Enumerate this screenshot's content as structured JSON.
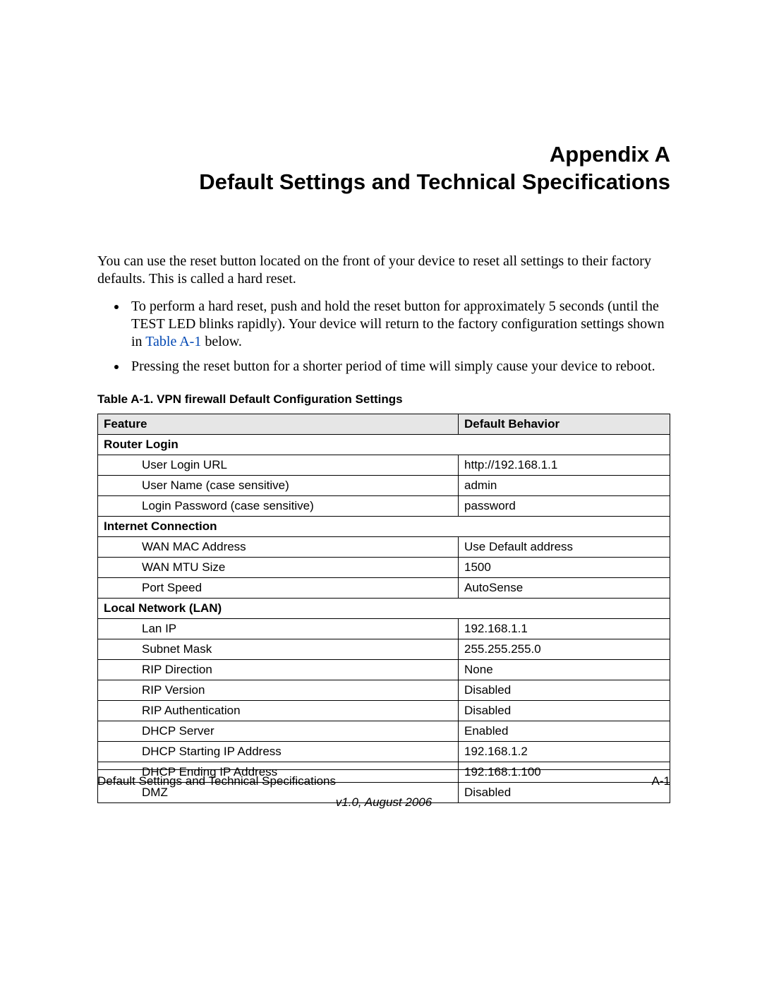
{
  "title_line1": "Appendix A",
  "title_line2": "Default Settings and Technical Specifications",
  "intro": "You can use the reset button located on the front of your device to reset all settings to their factory defaults. This is called a hard reset.",
  "bullet1_pre": "To perform a hard reset, push and hold the reset button for approximately 5 seconds (until the TEST LED blinks rapidly). Your device will return to the factory configuration settings shown in ",
  "bullet1_link": "Table A-1",
  "bullet1_post": " below.",
  "bullet2": "Pressing the reset button for a shorter period of time will simply cause your device to reboot.",
  "table_caption": "Table A-1.  VPN firewall Default Configuration Settings",
  "headers": {
    "feature": "Feature",
    "behavior": "Default Behavior"
  },
  "sections": {
    "router_login": "Router Login",
    "internet": "Internet Connection",
    "lan": "Local Network (LAN)"
  },
  "rows": {
    "r1": {
      "f": "User Login URL",
      "v": "http://192.168.1.1"
    },
    "r2": {
      "f": "User Name (case sensitive)",
      "v": "admin"
    },
    "r3": {
      "f": "Login Password (case sensitive)",
      "v": "password"
    },
    "r4": {
      "f": "WAN MAC Address",
      "v": "Use Default address"
    },
    "r5": {
      "f": "WAN MTU Size",
      "v": "1500"
    },
    "r6": {
      "f": "Port Speed",
      "v": "AutoSense"
    },
    "r7": {
      "f": "Lan IP",
      "v": "192.168.1.1"
    },
    "r8": {
      "f": "Subnet Mask",
      "v": "255.255.255.0"
    },
    "r9": {
      "f": "RIP Direction",
      "v": "None"
    },
    "r10": {
      "f": "RIP Version",
      "v": "Disabled"
    },
    "r11": {
      "f": "RIP Authentication",
      "v": "Disabled"
    },
    "r12": {
      "f": "DHCP Server",
      "v": "Enabled"
    },
    "r13": {
      "f": "DHCP Starting IP Address",
      "v": "192.168.1.2"
    },
    "r14": {
      "f": "DHCP Ending IP Address",
      "v": "192.168.1.100"
    },
    "r15": {
      "f": "DMZ",
      "v": "Disabled"
    }
  },
  "footer": {
    "left": "Default Settings and Technical Specifications",
    "right": "A-1",
    "version": "v1.0, August 2006"
  }
}
